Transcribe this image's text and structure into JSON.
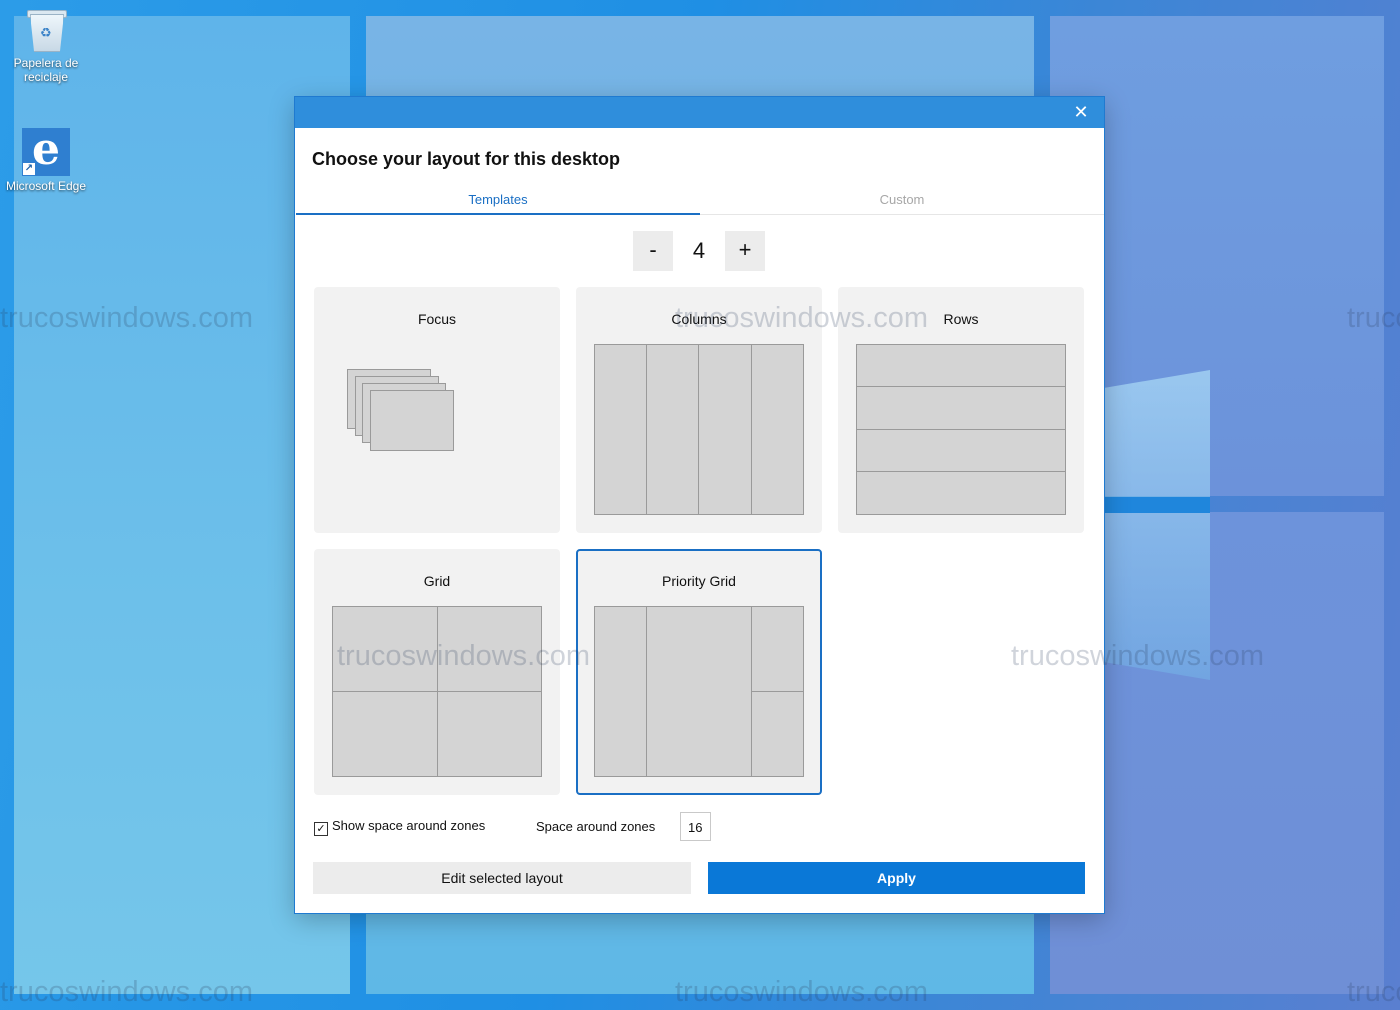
{
  "desktop": {
    "icons": [
      {
        "label": "Papelera de reciclaje",
        "icon": "recycle-bin-icon"
      },
      {
        "label": "Microsoft Edge",
        "icon": "edge-icon"
      }
    ],
    "watermark": "trucoswindows.com"
  },
  "dialog": {
    "close_glyph": "✕",
    "heading": "Choose your layout for this desktop",
    "tabs": [
      {
        "label": "Templates",
        "active": true
      },
      {
        "label": "Custom",
        "active": false
      }
    ],
    "zone_count": {
      "minus_label": "-",
      "value": "4",
      "plus_label": "+"
    },
    "layouts": [
      {
        "name": "Focus",
        "selected": false
      },
      {
        "name": "Columns",
        "selected": false
      },
      {
        "name": "Rows",
        "selected": false
      },
      {
        "name": "Grid",
        "selected": false
      },
      {
        "name": "Priority Grid",
        "selected": true
      }
    ],
    "show_space_checkbox": {
      "label": "Show space around zones",
      "checked": true,
      "check_glyph": "✓"
    },
    "space_around_zones": {
      "label": "Space around zones",
      "value": "16"
    },
    "buttons": {
      "edit": "Edit selected layout",
      "apply": "Apply"
    },
    "accent_color": "#0a78d7"
  }
}
